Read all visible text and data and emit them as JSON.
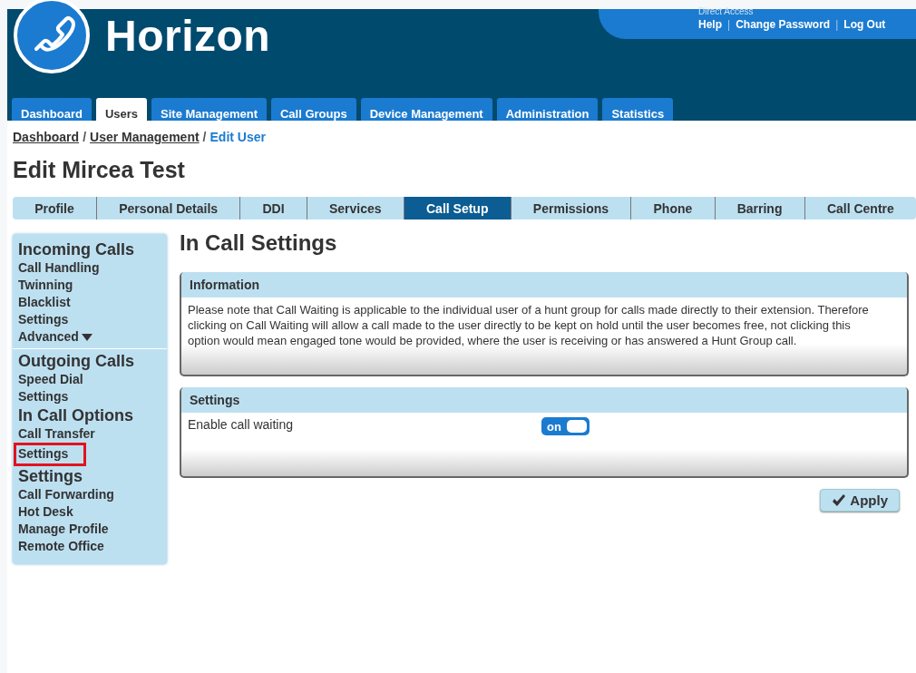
{
  "header": {
    "logo_text": "Horizon",
    "direct_access": "Direct Access",
    "links": [
      "Help",
      "Change Password",
      "Log Out"
    ],
    "link_separator": "|"
  },
  "main_tabs": [
    {
      "label": "Dashboard",
      "selected": false
    },
    {
      "label": "Users",
      "selected": true
    },
    {
      "label": "Site Management",
      "selected": false
    },
    {
      "label": "Call Groups",
      "selected": false
    },
    {
      "label": "Device Management",
      "selected": false
    },
    {
      "label": "Administration",
      "selected": false
    },
    {
      "label": "Statistics",
      "selected": false
    }
  ],
  "breadcrumb": [
    {
      "label": "Dashboard",
      "kind": "link"
    },
    {
      "label": "User Management",
      "kind": "link"
    },
    {
      "label": "Edit User",
      "kind": "current"
    }
  ],
  "breadcrumb_separator": "/",
  "page_title": "Edit Mircea Test",
  "sub_tabs": [
    {
      "label": "Profile",
      "selected": false
    },
    {
      "label": "Personal Details",
      "selected": false
    },
    {
      "label": "DDI",
      "selected": false
    },
    {
      "label": "Services",
      "selected": false
    },
    {
      "label": "Call Setup",
      "selected": true
    },
    {
      "label": "Permissions",
      "selected": false
    },
    {
      "label": "Phone",
      "selected": false
    },
    {
      "label": "Barring",
      "selected": false
    },
    {
      "label": "Call Centre",
      "selected": false
    }
  ],
  "sidebar": {
    "sections": [
      {
        "title": "Incoming Calls",
        "divider": true,
        "items": [
          {
            "label": "Call Handling",
            "selected": false
          },
          {
            "label": "Twinning",
            "selected": false
          },
          {
            "label": "Blacklist",
            "selected": false
          },
          {
            "label": "Settings",
            "selected": false
          },
          {
            "label": "Advanced",
            "selected": false,
            "dropdown": true
          }
        ]
      },
      {
        "title": "Outgoing Calls",
        "divider": false,
        "items": [
          {
            "label": "Speed Dial",
            "selected": false
          },
          {
            "label": "Settings",
            "selected": false
          }
        ]
      },
      {
        "title": "In Call Options",
        "divider": false,
        "items": [
          {
            "label": "Call Transfer",
            "selected": false
          },
          {
            "label": "Settings",
            "selected": true
          }
        ]
      },
      {
        "title": "Settings",
        "divider": false,
        "items": [
          {
            "label": "Call Forwarding",
            "selected": false
          },
          {
            "label": "Hot Desk",
            "selected": false
          },
          {
            "label": "Manage Profile",
            "selected": false
          },
          {
            "label": "Remote Office",
            "selected": false
          }
        ]
      }
    ]
  },
  "content_title": "In Call Settings",
  "info_panel": {
    "title": "Information",
    "text": "Please note that Call Waiting is applicable to the individual user of a hunt group for calls made directly to their extension. Therefore clicking on Call Waiting will allow a call made to the user directly to be kept on hold until the user becomes free, not clicking this option would mean engaged tone would be provided, where the user is receiving or has answered a Hunt Group call."
  },
  "settings_panel": {
    "title": "Settings",
    "rows": [
      {
        "label": "Enable call waiting",
        "toggle_text": "on",
        "on": true
      }
    ]
  },
  "apply_button": "Apply"
}
